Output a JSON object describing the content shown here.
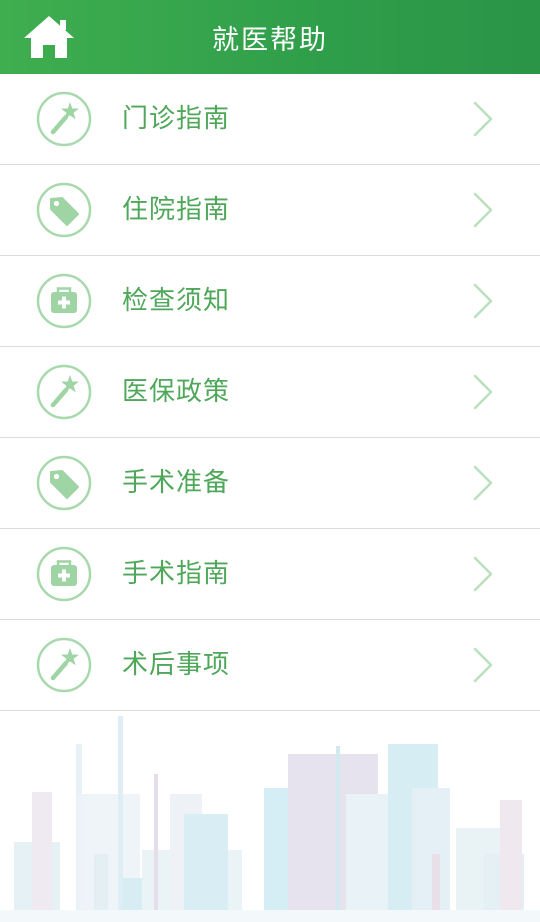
{
  "header": {
    "title": "就医帮助",
    "home_icon": "home-icon"
  },
  "colors": {
    "header_green": "#2f9e4a",
    "accent_green": "#4fa75a",
    "icon_green": "#9fd4a4"
  },
  "menu": {
    "items": [
      {
        "label": "门诊指南",
        "icon": "magic-wand-icon"
      },
      {
        "label": "住院指南",
        "icon": "tag-icon"
      },
      {
        "label": "检查须知",
        "icon": "medical-kit-icon"
      },
      {
        "label": "医保政策",
        "icon": "magic-wand-icon"
      },
      {
        "label": "手术准备",
        "icon": "tag-icon"
      },
      {
        "label": "手术指南",
        "icon": "medical-kit-icon"
      },
      {
        "label": "术后事项",
        "icon": "magic-wand-icon"
      }
    ]
  }
}
